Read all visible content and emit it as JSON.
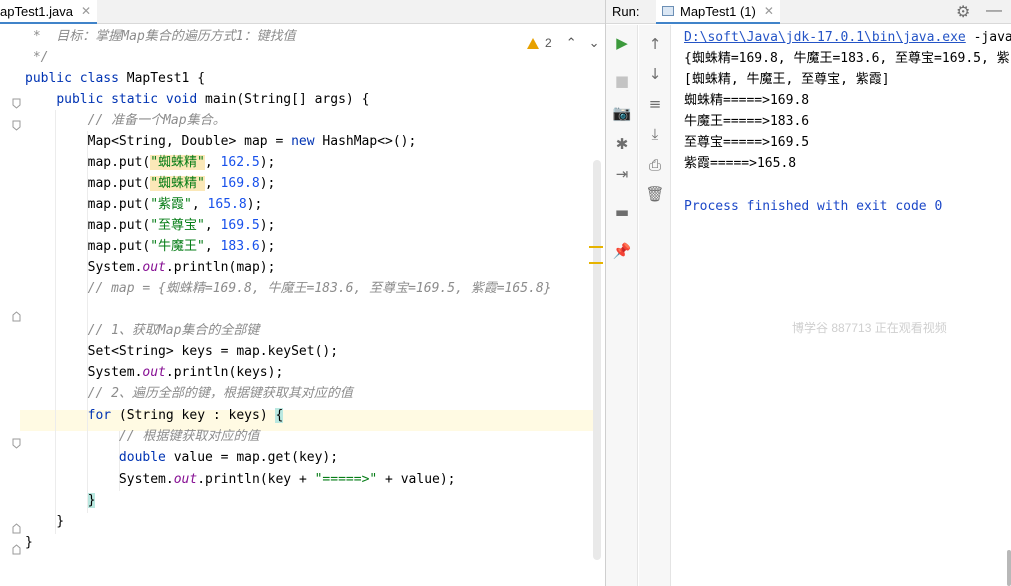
{
  "editor": {
    "tab_title": "apTest1.java",
    "warning_count": "2",
    "code_lines": [
      " *  目标：掌握Map集合的遍历方式1：键找值",
      " */",
      "public class MapTest1 {",
      "    public static void main(String[] args) {",
      "        // 准备一个Map集合。",
      "        Map<String, Double> map = new HashMap<>();",
      "        map.put(\"蜘蛛精\", 162.5);",
      "        map.put(\"蜘蛛精\", 169.8);",
      "        map.put(\"紫霞\", 165.8);",
      "        map.put(\"至尊宝\", 169.5);",
      "        map.put(\"牛魔王\", 183.6);",
      "        System.out.println(map);",
      "        // map = {蜘蛛精=169.8, 牛魔王=183.6, 至尊宝=169.5, 紫霞=165.8}",
      "",
      "        // 1、获取Map集合的全部键",
      "        Set<String> keys = map.keySet();",
      "        System.out.println(keys);",
      "        // 2、遍历全部的键，根据键获取其对应的值",
      "        for (String key : keys) {",
      "            // 根据键获取对应的值",
      "            double value = map.get(key);",
      "            System.out.println(key + \"=====>\" + value);",
      "        }",
      "    }",
      "}"
    ]
  },
  "run": {
    "label": "Run:",
    "tab_title": "MapTest1 (1)",
    "command_path": "D:\\soft\\Java\\jdk-17.0.1\\bin\\java.exe",
    "command_rest": " -java",
    "output_lines": [
      "{蜘蛛精=169.8, 牛魔王=183.6, 至尊宝=169.5, 紫",
      "[蜘蛛精, 牛魔王, 至尊宝, 紫霞]",
      "蜘蛛精=====>169.8",
      "牛魔王=====>183.6",
      "至尊宝=====>169.5",
      "紫霞=====>165.8",
      "",
      "Process finished with exit code 0"
    ],
    "watermark": "博学谷 887713 正在观看视频",
    "toolbar_left": [
      "run-icon",
      "stop-icon",
      "camera-icon",
      "debug-bug-icon",
      "exit-icon",
      "layout-icon",
      "pin-icon"
    ],
    "toolbar_right": [
      "arrow-up-icon",
      "arrow-down-icon",
      "soft-wrap-icon",
      "scroll-to-end-icon",
      "print-icon",
      "trash-icon"
    ]
  }
}
